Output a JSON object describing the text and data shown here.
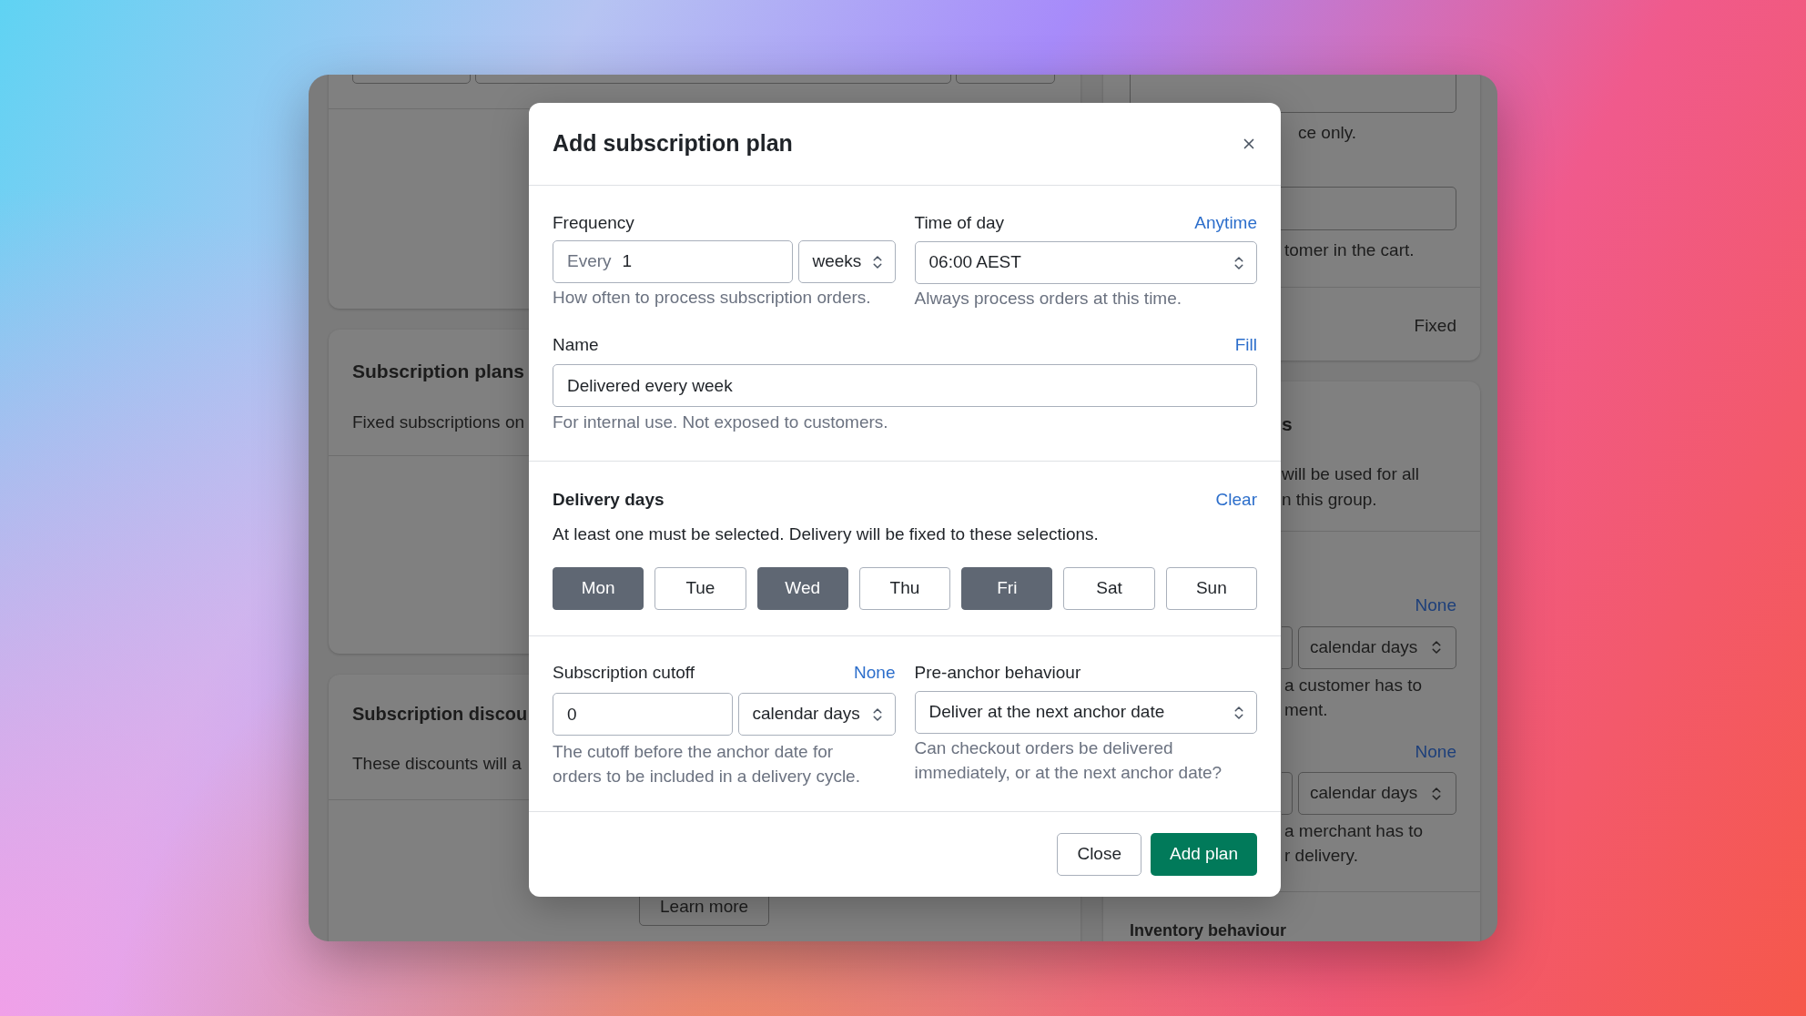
{
  "background_page": {
    "left": {
      "plans_card": {
        "title": "Subscription plans",
        "text": "Fixed subscriptions on"
      },
      "discounts_card": {
        "title": "Subscription discou",
        "text": "These discounts will a",
        "button": "Learn more"
      }
    },
    "right": {
      "notes": [
        "ce only.",
        "tomer in the cart."
      ],
      "value": "Fixed",
      "heading": "s",
      "description": [
        "will be used for all",
        "n this group."
      ],
      "settings": [
        {
          "link": "None",
          "unit": "calendar days",
          "help": [
            "a customer has to",
            "ment."
          ]
        },
        {
          "link": "None",
          "unit": "calendar days",
          "help": [
            "a merchant has to",
            "r delivery."
          ]
        }
      ],
      "next_heading": "Inventory behaviour"
    }
  },
  "dialog": {
    "title": "Add subscription plan",
    "frequency": {
      "label": "Frequency",
      "prefix": "Every",
      "value": "1",
      "unit": "weeks",
      "help": "How often to process subscription orders."
    },
    "time_of_day": {
      "label": "Time of day",
      "action": "Anytime",
      "value": "06:00 AEST",
      "help": "Always process orders at this time."
    },
    "name": {
      "label": "Name",
      "action": "Fill",
      "value": "Delivered every week",
      "help": "For internal use. Not exposed to customers."
    },
    "delivery_days": {
      "title": "Delivery days",
      "action": "Clear",
      "help": "At least one must be selected. Delivery will be fixed to these selections.",
      "days": [
        {
          "label": "Mon",
          "selected": true
        },
        {
          "label": "Tue",
          "selected": false
        },
        {
          "label": "Wed",
          "selected": true
        },
        {
          "label": "Thu",
          "selected": false
        },
        {
          "label": "Fri",
          "selected": true
        },
        {
          "label": "Sat",
          "selected": false
        },
        {
          "label": "Sun",
          "selected": false
        }
      ]
    },
    "cutoff": {
      "label": "Subscription cutoff",
      "action": "None",
      "value": "0",
      "unit": "calendar days",
      "help": "The cutoff before the anchor date for orders to be included in a delivery cycle."
    },
    "pre_anchor": {
      "label": "Pre-anchor behaviour",
      "value": "Deliver at the next anchor date",
      "help": "Can checkout orders be delivered immediately, or at the next anchor date?"
    },
    "buttons": [
      {
        "label": "Close",
        "kind": "secondary"
      },
      {
        "label": "Add plan",
        "kind": "primary"
      }
    ]
  }
}
